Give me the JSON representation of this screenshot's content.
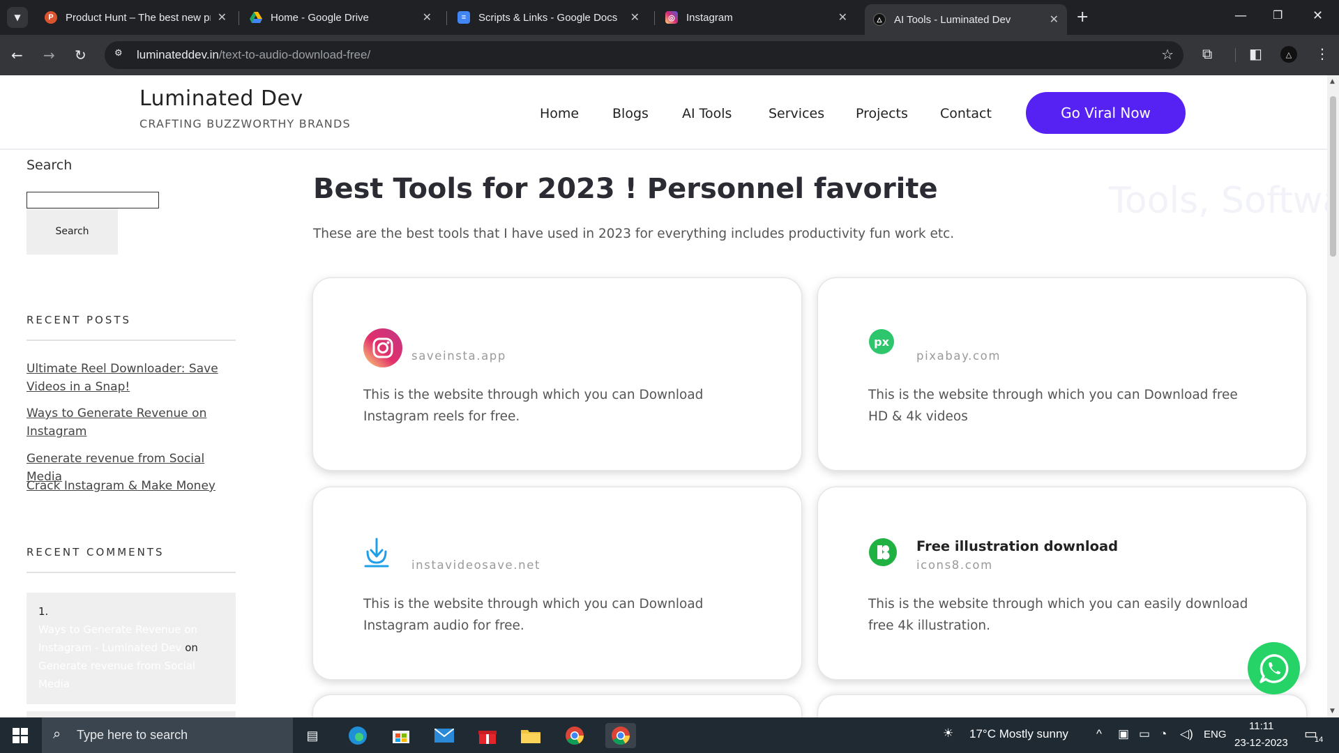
{
  "browser": {
    "tabs": [
      {
        "title": "Product Hunt – The best new products",
        "favicon": "P",
        "color": "#da552f"
      },
      {
        "title": "Home - Google Drive",
        "favicon": "drive-icon",
        "color": "#1fa463"
      },
      {
        "title": "Scripts & Links - Google Docs",
        "favicon": "docs-icon",
        "color": "#4285f4"
      },
      {
        "title": "Instagram",
        "favicon": "instagram-icon",
        "color": "#e1306c"
      },
      {
        "title": "AI Tools - Luminated Dev",
        "favicon": "luminated-icon",
        "color": "#202124"
      }
    ],
    "url_host": "luminateddev.in",
    "url_path": "/text-to-audio-download-free/"
  },
  "site": {
    "brand_title": "Luminated Dev",
    "brand_tagline": "CRAFTING BUZZWORTHY BRANDS",
    "nav": [
      "Home",
      "Blogs",
      "AI Tools",
      "Services",
      "Projects",
      "Contact"
    ],
    "cta_label": "Go Viral Now"
  },
  "sidebar": {
    "search_label": "Search",
    "search_button": "Search",
    "recent_posts_heading": "RECENT POSTS",
    "recent_posts": [
      "Ultimate Reel Downloader: Save Videos in a Snap!",
      "Ways to Generate Revenue on Instagram",
      "Generate revenue from Social Media",
      "Crack Instagram & Make Money"
    ],
    "recent_comments_heading": "RECENT COMMENTS",
    "comment": {
      "number": "1.",
      "author": "Ways to Generate Revenue on Instagram - Luminated Dev",
      "on": "on",
      "post": "Generate revenue from Social Media"
    }
  },
  "main": {
    "title": "Best Tools for 2023 ! Personnel favorite",
    "ghost_text": "Tools, Softwa",
    "subtitle": "These are the best tools that I have used in 2023 for everything includes productivity fun work etc.",
    "cards": [
      {
        "name": "",
        "domain": "saveinsta.app",
        "description": "This is the website through which you can Download Instagram reels for free."
      },
      {
        "name": "",
        "domain": "pixabay.com",
        "description": "This is the website through which you can Download free HD & 4k videos"
      },
      {
        "name": "",
        "domain": "instavideosave.net",
        "description": "This is the website through which you can Download Instagram audio for free."
      },
      {
        "name": "Free illustration download",
        "domain": "icons8.com",
        "description": "This is the website through which you can easily download free 4k illustration."
      }
    ]
  },
  "taskbar": {
    "search_placeholder": "Type here to search",
    "weather": "17°C  Mostly sunny",
    "language": "ENG",
    "time": "11:11",
    "date": "23-12-2023",
    "notification_count": "14"
  },
  "colors": {
    "accent": "#5622f3",
    "whatsapp": "#25d366"
  }
}
